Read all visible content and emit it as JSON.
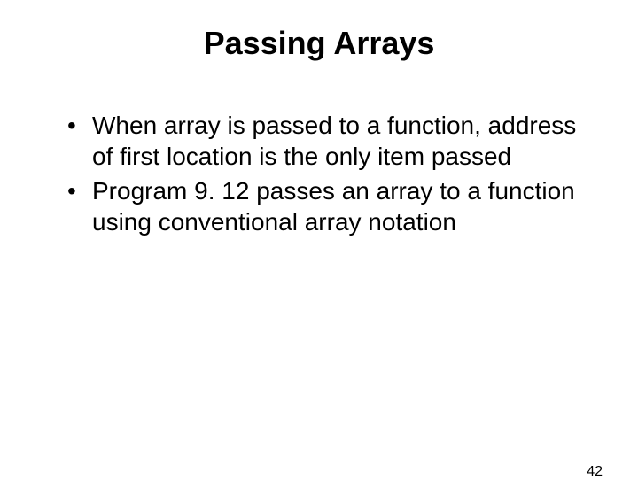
{
  "slide": {
    "title": "Passing Arrays",
    "bullets": [
      "When array is passed to a function, address of first location is the only item passed",
      "Program 9. 12 passes an array to a function using conventional array notation"
    ],
    "page_number": "42"
  }
}
